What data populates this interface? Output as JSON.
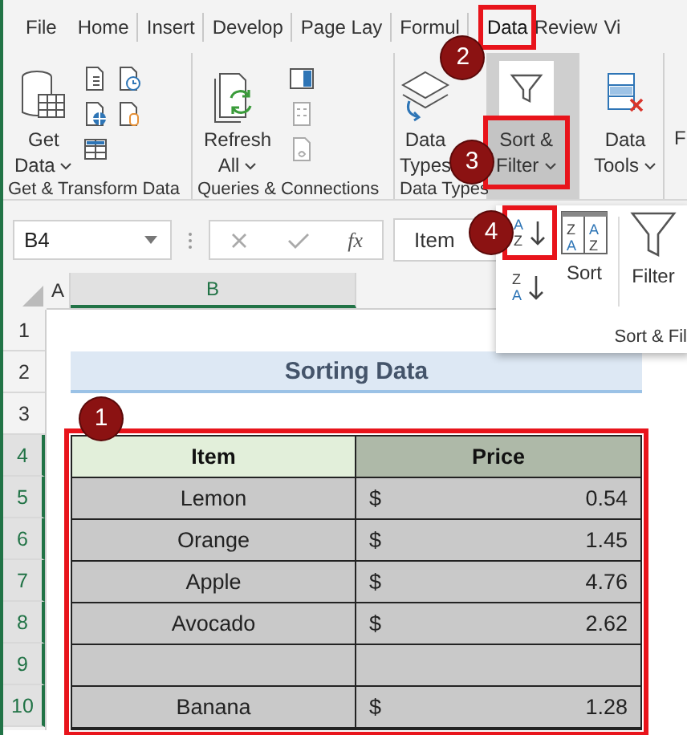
{
  "tabs": [
    {
      "label": "File",
      "selected": false,
      "highlighted": false
    },
    {
      "label": "Home",
      "selected": false,
      "highlighted": false
    },
    {
      "label": "Insert",
      "selected": false,
      "highlighted": false
    },
    {
      "label": "Develop",
      "selected": false,
      "highlighted": false
    },
    {
      "label": "Page Lay",
      "selected": false,
      "highlighted": false
    },
    {
      "label": "Formul",
      "selected": false,
      "highlighted": false
    },
    {
      "label": "Data",
      "selected": true,
      "highlighted": true,
      "callout": "2"
    },
    {
      "label": "Review",
      "selected": false,
      "highlighted": false
    },
    {
      "label": "Vi",
      "selected": false,
      "highlighted": false
    }
  ],
  "ribbon_groups": [
    {
      "kind": "get-transform",
      "label": "Get & Transform Data",
      "button": {
        "label": [
          "Get",
          "Data"
        ],
        "dropdown": true,
        "highlighted": false
      }
    },
    {
      "kind": "queries",
      "label": "Queries & Connections",
      "button": {
        "label": [
          "Refresh",
          "All"
        ],
        "dropdown": true,
        "highlighted": false
      }
    },
    {
      "kind": "data-types",
      "label": "Data Types",
      "button": {
        "label": [
          "Data",
          "Types"
        ],
        "dropdown": false,
        "highlighted": false
      }
    },
    {
      "kind": "sort-filter",
      "button": {
        "label": [
          "Sort &",
          "Filter"
        ],
        "dropdown": true,
        "highlighted": true,
        "callout": "3"
      }
    },
    {
      "kind": "data-tools",
      "button": {
        "label": [
          "Data",
          "Tools"
        ],
        "dropdown": true,
        "highlighted": false
      }
    },
    {
      "kind": "cut",
      "button": {
        "label": [
          "F"
        ],
        "highlighted": false
      }
    }
  ],
  "sort_panel": {
    "sort_buttons": [
      {
        "kind": "ascending",
        "letters": [
          "A",
          "Z"
        ],
        "highlighted": true,
        "callout": "4"
      },
      {
        "kind": "descending",
        "letters": [
          "Z",
          "A"
        ],
        "highlighted": false
      }
    ],
    "sort": {
      "label": "Sort",
      "letters": [
        "Z",
        "A",
        "A",
        "Z"
      ]
    },
    "filter": {
      "label": "Filter"
    },
    "label": "Sort & Fil"
  },
  "formula_bar": {
    "name_box": "B4",
    "function_label": "fx",
    "formula": "Item"
  },
  "sheet": {
    "columns": [
      {
        "label": "A",
        "selected": false
      },
      {
        "label": "B",
        "selected": true
      }
    ],
    "rows": [
      {
        "label": "1",
        "selected": false
      },
      {
        "label": "2",
        "selected": false
      },
      {
        "label": "3",
        "selected": false
      },
      {
        "label": "4",
        "selected": true
      },
      {
        "label": "5",
        "selected": true
      },
      {
        "label": "6",
        "selected": true
      },
      {
        "label": "7",
        "selected": true
      },
      {
        "label": "8",
        "selected": true
      },
      {
        "label": "9",
        "selected": true
      },
      {
        "label": "10",
        "selected": true
      }
    ],
    "title": "Sorting Data",
    "table": {
      "highlighted": true,
      "callout": "1",
      "columns": [
        "Item",
        "Price"
      ],
      "rows": [
        {
          "item": "Lemon",
          "currency": "$",
          "price": "0.54"
        },
        {
          "item": "Orange",
          "currency": "$",
          "price": "1.45"
        },
        {
          "item": "Apple",
          "currency": "$",
          "price": "4.76"
        },
        {
          "item": "Avocado",
          "currency": "$",
          "price": "2.62"
        },
        {},
        {
          "item": "Banana",
          "currency": "$",
          "price": "1.28"
        }
      ]
    }
  }
}
